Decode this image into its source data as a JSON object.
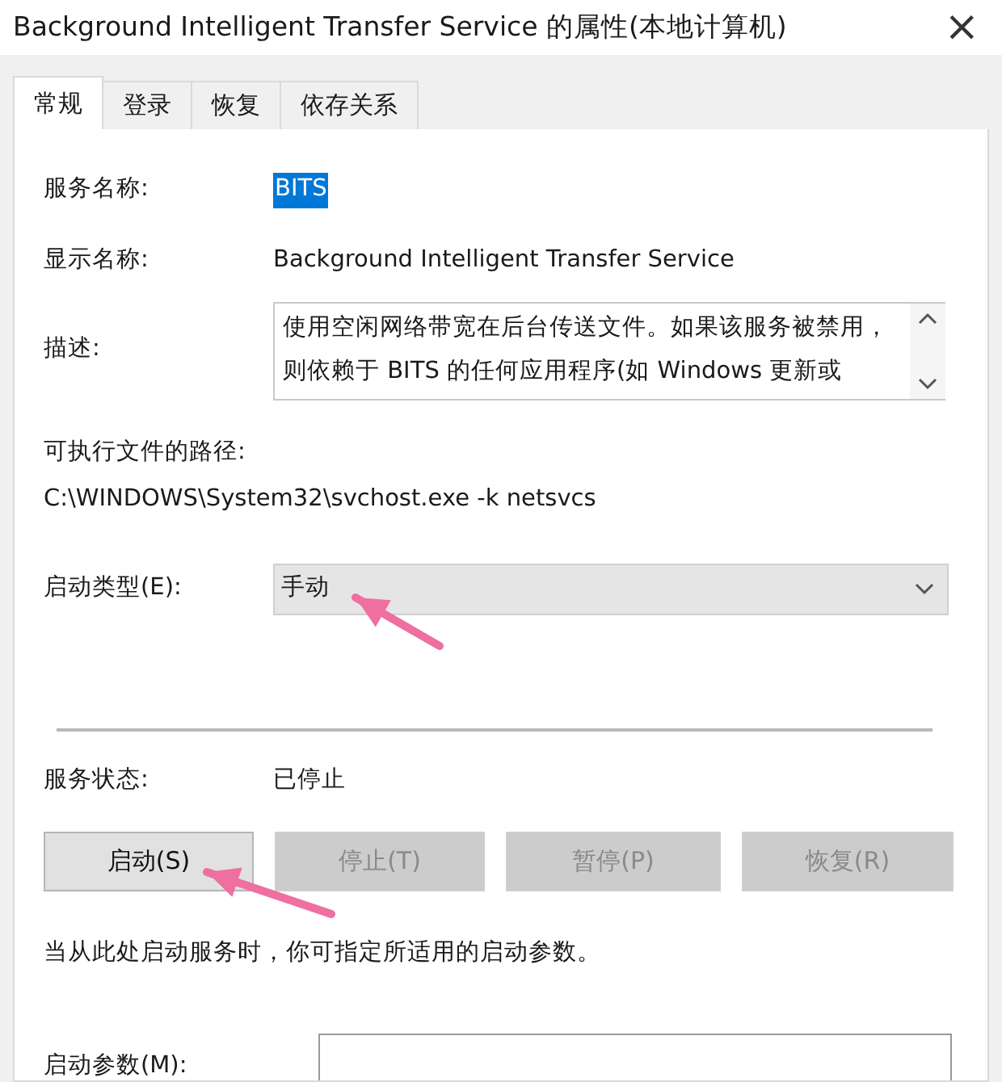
{
  "window": {
    "title": "Background Intelligent Transfer Service 的属性(本地计算机)",
    "close": "×"
  },
  "tabs": [
    {
      "label": "常规",
      "selected": true
    },
    {
      "label": "登录",
      "selected": false
    },
    {
      "label": "恢复",
      "selected": false
    },
    {
      "label": "依存关系",
      "selected": false
    }
  ],
  "service_name": {
    "label": "服务名称:",
    "value": "BITS",
    "selected": true
  },
  "display_name": {
    "label": "显示名称:",
    "value": "Background Intelligent Transfer Service"
  },
  "description": {
    "label": "描述:",
    "value": "使用空闲网络带宽在后台传送文件。如果该服务被禁用，则依赖于 BITS 的任何应用程序(如 Windows 更新或"
  },
  "executable_path": {
    "label": "可执行文件的路径:",
    "value": "C:\\WINDOWS\\System32\\svchost.exe -k netsvcs"
  },
  "startup_type": {
    "label": "启动类型(E):",
    "value": "手动"
  },
  "service_status": {
    "label": "服务状态:",
    "value": "已停止"
  },
  "buttons": [
    {
      "label": "启动(S)",
      "disabled": false
    },
    {
      "label": "停止(T)",
      "disabled": true
    },
    {
      "label": "暂停(P)",
      "disabled": true
    },
    {
      "label": "恢复(R)",
      "disabled": true
    }
  ],
  "note": "当从此处启动服务时，你可指定所适用的启动参数。",
  "start_parameters": {
    "label": "启动参数(M):"
  },
  "annotations": [
    {
      "kind": "arrow"
    },
    {
      "kind": "arrow"
    }
  ]
}
